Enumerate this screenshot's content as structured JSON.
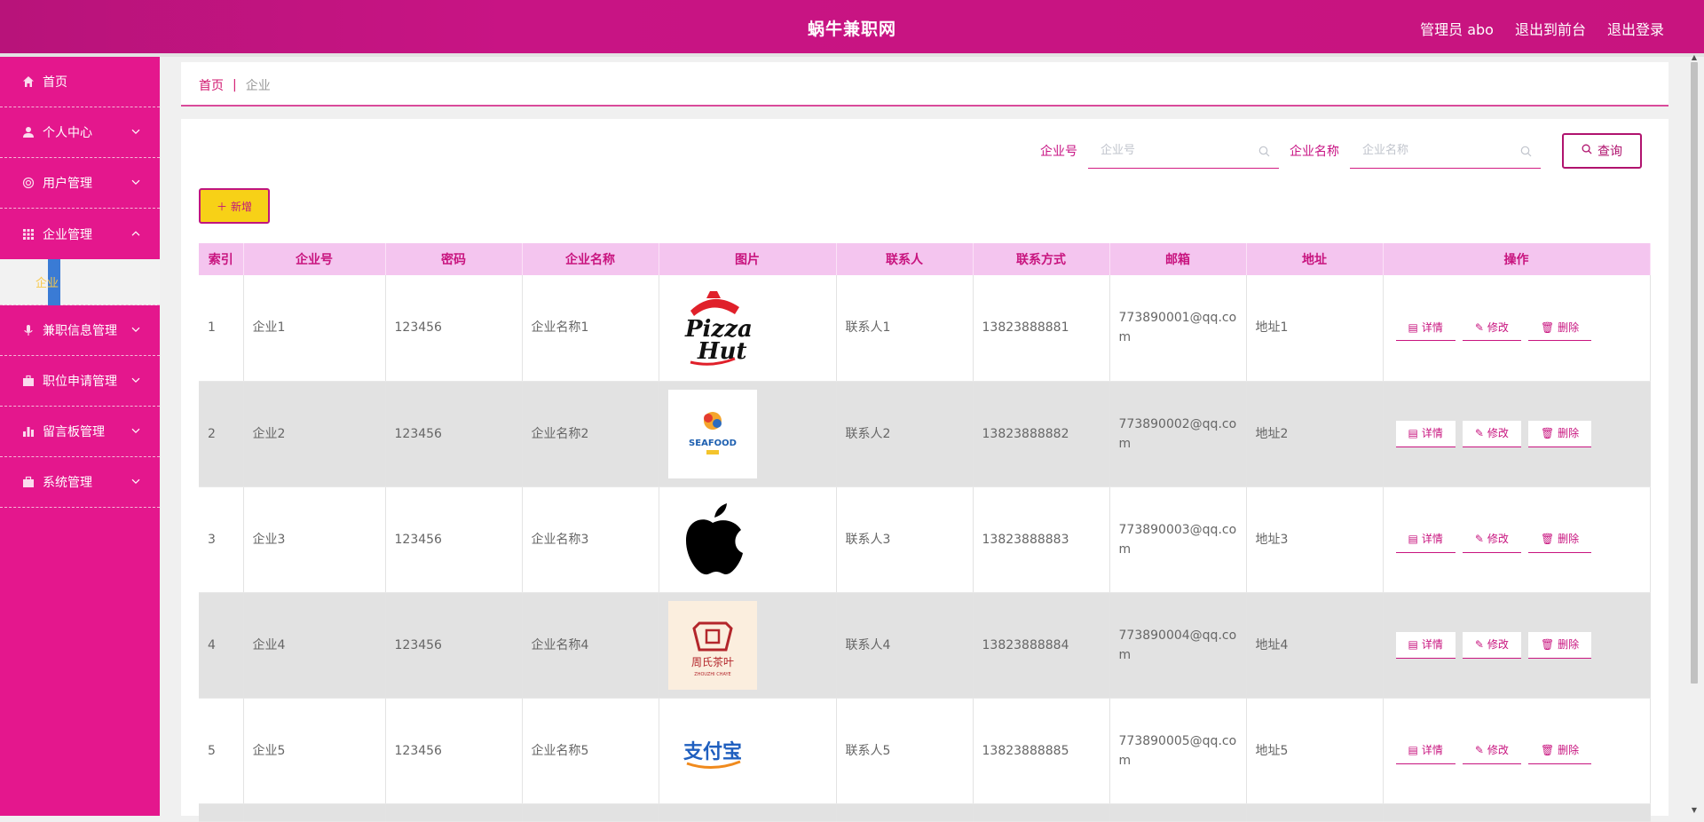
{
  "header": {
    "title": "蜗牛兼职网",
    "links": [
      "管理员 abo",
      "退出到前台",
      "退出登录"
    ]
  },
  "sidebar": {
    "items": [
      {
        "label": "首页",
        "icon": "home-icon",
        "chevron": ""
      },
      {
        "label": "个人中心",
        "icon": "user-icon",
        "chevron": "down"
      },
      {
        "label": "用户管理",
        "icon": "globe-icon",
        "chevron": "down"
      },
      {
        "label": "企业管理",
        "icon": "grid-icon",
        "chevron": "up"
      },
      {
        "label": "兼职信息管理",
        "icon": "mic-icon",
        "chevron": "down"
      },
      {
        "label": "职位申请管理",
        "icon": "briefcase-icon",
        "chevron": "down"
      },
      {
        "label": "留言板管理",
        "icon": "bar-chart-icon",
        "chevron": "down"
      },
      {
        "label": "系统管理",
        "icon": "gear-icon",
        "chevron": "down"
      }
    ],
    "submenu": {
      "label": "企业"
    }
  },
  "breadcrumb": {
    "home": "首页",
    "sep": "|",
    "current": "企业"
  },
  "search": {
    "field1_label": "企业号",
    "field1_placeholder": "企业号",
    "field2_label": "企业名称",
    "field2_placeholder": "企业名称",
    "query_label": "查询"
  },
  "add_label": "新增",
  "table": {
    "columns": [
      "索引",
      "企业号",
      "密码",
      "企业名称",
      "图片",
      "联系人",
      "联系方式",
      "邮箱",
      "地址",
      "操作"
    ],
    "rows": [
      {
        "index": "1",
        "code": "企业1",
        "password": "123456",
        "name": "企业名称1",
        "logo": "pizza-hut-logo",
        "contact": "联系人1",
        "phone": "13823888881",
        "email": "773890001@qq.com",
        "address": "地址1"
      },
      {
        "index": "2",
        "code": "企业2",
        "password": "123456",
        "name": "企业名称2",
        "logo": "seafood-logo",
        "contact": "联系人2",
        "phone": "13823888882",
        "email": "773890002@qq.com",
        "address": "地址2"
      },
      {
        "index": "3",
        "code": "企业3",
        "password": "123456",
        "name": "企业名称3",
        "logo": "apple-logo",
        "contact": "联系人3",
        "phone": "13823888883",
        "email": "773890003@qq.com",
        "address": "地址3"
      },
      {
        "index": "4",
        "code": "企业4",
        "password": "123456",
        "name": "企业名称4",
        "logo": "zhoushi-tea-logo",
        "contact": "联系人4",
        "phone": "13823888884",
        "email": "773890004@qq.com",
        "address": "地址4"
      },
      {
        "index": "5",
        "code": "企业5",
        "password": "123456",
        "name": "企业名称5",
        "logo": "alipay-logo",
        "contact": "联系人5",
        "phone": "13823888885",
        "email": "773890005@qq.com",
        "address": "地址5"
      }
    ],
    "actions": {
      "detail": "详情",
      "edit": "修改",
      "delete": "删除"
    }
  },
  "logo_text": {
    "pizza_1": "Pizza",
    "pizza_2": "Hut",
    "seafood": "SEAFOOD",
    "zhoushi_main": "周氏茶叶",
    "zhoushi_sub": "ZHOUZHI CHAYE",
    "alipay": "支付宝"
  },
  "colors": {
    "primary": "#c8147f",
    "sidebar": "#e4178d",
    "header_bg": "#f4c5ef",
    "add_button": "#f7d117"
  }
}
